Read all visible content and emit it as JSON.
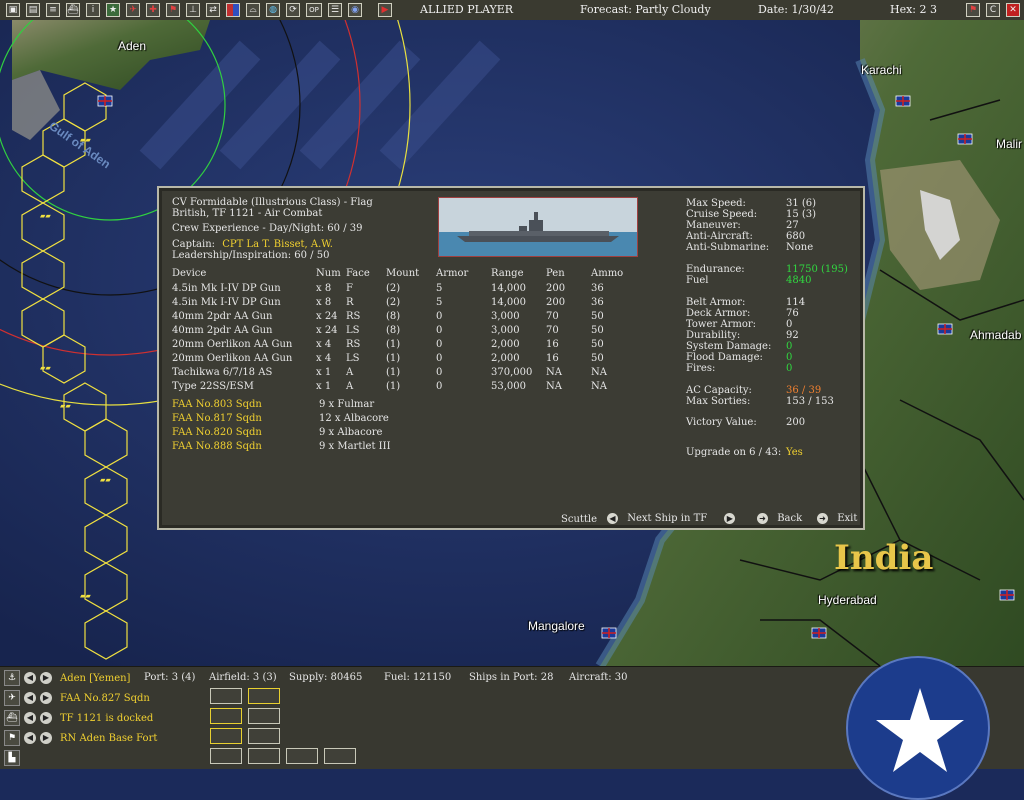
{
  "toolbar": {
    "buttons": [
      "save-icon",
      "report-icon",
      "list-icon",
      "ship-icon",
      "info-icon",
      "star-icon",
      "air-icon",
      "target-icon",
      "flag-icon",
      "chart-icon",
      "transfer-icon",
      "color-icon",
      "sub-icon",
      "globe-icon",
      "refresh-icon",
      "op-icon",
      "menu-icon",
      "disk-icon",
      "play-icon"
    ],
    "op_label": "OP",
    "info_label": "i",
    "player": "ALLIED PLAYER",
    "forecast": "Forecast: Partly Cloudy",
    "date": "Date: 1/30/42",
    "hex": "Hex: 2 3",
    "right_buttons": {
      "flag": "⚑",
      "c": "C",
      "close": "✕"
    }
  },
  "map": {
    "labels": {
      "aden": "Aden",
      "karachi": "Karachi",
      "malir": "Malir",
      "ahmadabad": "Ahmadab",
      "india": "India",
      "hyderabad": "Hyderabad",
      "mangalore": "Mangalore",
      "gulf": "Gulf of Aden"
    },
    "colors": {
      "ocean": "#1e2e62",
      "land": "#3f5a2a",
      "hex_yellow": "#f0e040",
      "ring_green": "#30d040",
      "ring_red": "#d03030"
    }
  },
  "dialog": {
    "ship_name": "CV Formidable (Illustrious Class) - Flag",
    "ship_tf": "British, TF 1121 - Air Combat",
    "crew_exp": "Crew Experience - Day/Night: 60 / 39",
    "captain_label": "Captain:",
    "captain_name": "CPT La T. Bisset, A.W.",
    "leadership": "Leadership/Inspiration: 60 / 50",
    "headers": [
      "Device",
      "Num",
      "Face",
      "Mount",
      "Armor",
      "Range",
      "Pen",
      "Ammo"
    ],
    "devices": [
      [
        "4.5in Mk I-IV DP Gun",
        "x 8",
        "F",
        "(2)",
        "5",
        "14,000",
        "200",
        "36"
      ],
      [
        "4.5in Mk I-IV DP Gun",
        "x 8",
        "R",
        "(2)",
        "5",
        "14,000",
        "200",
        "36"
      ],
      [
        "40mm 2pdr AA Gun",
        "x 24",
        "RS",
        "(8)",
        "0",
        "3,000",
        "70",
        "50"
      ],
      [
        "40mm 2pdr AA Gun",
        "x 24",
        "LS",
        "(8)",
        "0",
        "3,000",
        "70",
        "50"
      ],
      [
        "20mm Oerlikon AA Gun",
        "x 4",
        "RS",
        "(1)",
        "0",
        "2,000",
        "16",
        "50"
      ],
      [
        "20mm Oerlikon AA Gun",
        "x 4",
        "LS",
        "(1)",
        "0",
        "2,000",
        "16",
        "50"
      ],
      [
        "Tachikwa 6/7/18 AS",
        "x 1",
        "A",
        "(1)",
        "0",
        "370,000",
        "NA",
        "NA"
      ],
      [
        "Type 22SS/ESM",
        "x 1",
        "A",
        "(1)",
        "0",
        "53,000",
        "NA",
        "NA"
      ]
    ],
    "squadrons": [
      [
        "FAA No.803 Sqdn",
        "9 x Fulmar"
      ],
      [
        "FAA No.817 Sqdn",
        "12 x Albacore"
      ],
      [
        "FAA No.820 Sqdn",
        "9 x Albacore"
      ],
      [
        "FAA No.888 Sqdn",
        "9 x Martlet III"
      ]
    ],
    "stats": {
      "max_speed_label": "Max Speed:",
      "max_speed": "31 (6)",
      "cruise_speed_label": "Cruise Speed:",
      "cruise_speed": "15 (3)",
      "maneuver_label": "Maneuver:",
      "maneuver": "27",
      "anti_aircraft_label": "Anti-Aircraft:",
      "anti_aircraft": "680",
      "anti_sub_label": "Anti-Submarine:",
      "anti_sub": "None",
      "endurance_label": "Endurance:",
      "endurance": "11750 (195)",
      "fuel_label": "Fuel",
      "fuel": "4840",
      "belt_armor_label": "Belt Armor:",
      "belt_armor": "114",
      "deck_armor_label": "Deck Armor:",
      "deck_armor": "76",
      "tower_armor_label": "Tower Armor:",
      "tower_armor": "0",
      "durability_label": "Durability:",
      "durability": "92",
      "system_damage_label": "System Damage:",
      "system_damage": "0",
      "flood_damage_label": "Flood Damage:",
      "flood_damage": "0",
      "fires_label": "Fires:",
      "fires": "0",
      "ac_capacity_label": "AC Capacity:",
      "ac_capacity": "36 / 39",
      "max_sorties_label": "Max Sorties:",
      "max_sorties": "153 / 153",
      "victory_label": "Victory Value:",
      "victory": "200",
      "upgrade_label": "Upgrade on 6 / 43:",
      "upgrade": "Yes"
    },
    "buttons": {
      "scuttle": "Scuttle",
      "next_ship": "Next Ship in TF",
      "back": "Back",
      "exit": "Exit"
    }
  },
  "bottombar": {
    "rows": [
      {
        "icon": "base-icon",
        "label": "Aden [Yemen]"
      },
      {
        "icon": "aircraft-icon",
        "label": "FAA No.827 Sqdn"
      },
      {
        "icon": "ship-icon",
        "label": "TF 1121 is docked"
      },
      {
        "icon": "flag-icon",
        "label": "RN Aden Base Fort"
      },
      {
        "icon": "factory-icon",
        "label": ""
      }
    ],
    "port": "Port: 3 (4)",
    "airfield": "Airfield: 3 (3)",
    "supply": "Supply: 80465",
    "fuel": "Fuel: 121150",
    "ships_in_port": "Ships in Port: 28",
    "aircraft": "Aircraft: 30"
  }
}
